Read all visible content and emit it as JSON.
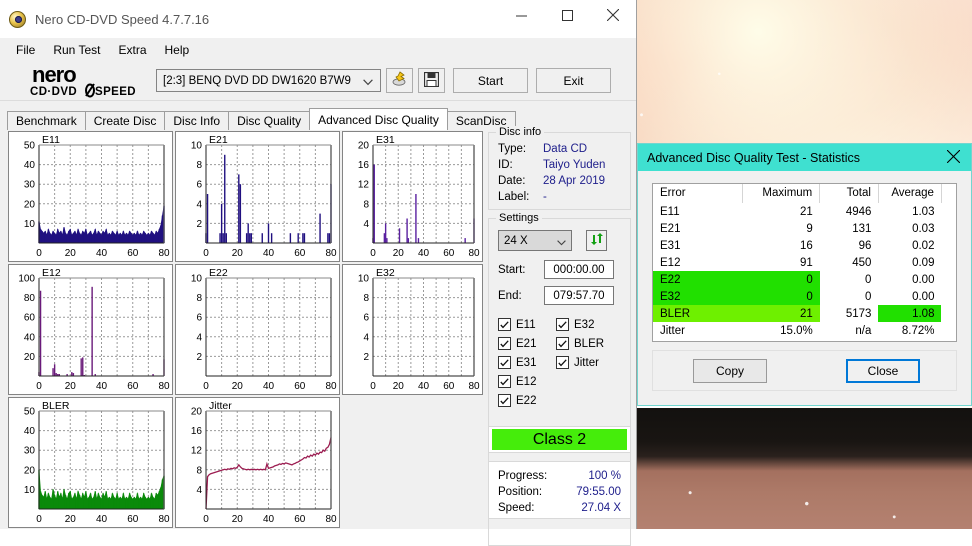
{
  "window": {
    "title": "Nero CD-DVD Speed 4.7.7.16",
    "icon": "nero-disc-icon",
    "minimize_label": "─",
    "maximize_label": "□",
    "close_label": "✕"
  },
  "menubar": {
    "items": [
      "File",
      "Run Test",
      "Extra",
      "Help"
    ]
  },
  "toolbar": {
    "logo_primary": "nero",
    "logo_secondary": "CD·DVD SPEED",
    "drive": "[2:3]   BENQ DVD DD DW1620 B7W9",
    "eject_icon": "eject-disc-icon",
    "save_icon": "floppy-save-icon",
    "start_label": "Start",
    "exit_label": "Exit"
  },
  "tabs": [
    {
      "label": "Benchmark",
      "active": false
    },
    {
      "label": "Create Disc",
      "active": false
    },
    {
      "label": "Disc Info",
      "active": false
    },
    {
      "label": "Disc Quality",
      "active": false
    },
    {
      "label": "Advanced Disc Quality",
      "active": true
    },
    {
      "label": "ScanDisc",
      "active": false
    }
  ],
  "disc_info": {
    "legend": "Disc info",
    "rows": [
      {
        "key": "Type:",
        "value": "Data CD"
      },
      {
        "key": "ID:",
        "value": "Taiyo Yuden"
      },
      {
        "key": "Date:",
        "value": "28 Apr 2019"
      },
      {
        "key": "Label:",
        "value": "-"
      }
    ]
  },
  "settings": {
    "legend": "Settings",
    "speed": "24 X",
    "refresh_icon": "refresh-icon",
    "start_label": "Start:",
    "start_value": "000:00.00",
    "end_label": "End:",
    "end_value": "079:57.70",
    "checkboxes_left": [
      {
        "label": "E11",
        "checked": true
      },
      {
        "label": "E21",
        "checked": true
      },
      {
        "label": "E31",
        "checked": true
      },
      {
        "label": "E12",
        "checked": true
      },
      {
        "label": "E22",
        "checked": true
      }
    ],
    "checkboxes_right": [
      {
        "label": "E32",
        "checked": true
      },
      {
        "label": "BLER",
        "checked": true
      },
      {
        "label": "Jitter",
        "checked": true
      }
    ]
  },
  "result": {
    "class_label": "Class 2",
    "class_color": "#45ed0b"
  },
  "progress": {
    "rows": [
      {
        "key": "Progress:",
        "value": "100 %"
      },
      {
        "key": "Position:",
        "value": "79:55.00"
      },
      {
        "key": "Speed:",
        "value": "27.04 X"
      }
    ]
  },
  "stats_dialog": {
    "title": "Advanced Disc Quality Test - Statistics",
    "close_icon": "close-icon",
    "columns": [
      "Error",
      "Maximum",
      "Total",
      "Average"
    ],
    "rows": [
      {
        "error": "E11",
        "maximum": "21",
        "total": "4946",
        "average": "1.03",
        "highlight": "none"
      },
      {
        "error": "E21",
        "maximum": "9",
        "total": "131",
        "average": "0.03",
        "highlight": "none"
      },
      {
        "error": "E31",
        "maximum": "16",
        "total": "96",
        "average": "0.02",
        "highlight": "none"
      },
      {
        "error": "E12",
        "maximum": "91",
        "total": "450",
        "average": "0.09",
        "highlight": "none"
      },
      {
        "error": "E22",
        "maximum": "0",
        "total": "0",
        "average": "0.00",
        "highlight": "left"
      },
      {
        "error": "E32",
        "maximum": "0",
        "total": "0",
        "average": "0.00",
        "highlight": "left"
      },
      {
        "error": "BLER",
        "maximum": "21",
        "total": "5173",
        "average": "1.08",
        "highlight": "bler"
      },
      {
        "error": "Jitter",
        "maximum": "15.0%",
        "total": "n/a",
        "average": "8.72%",
        "highlight": "none"
      }
    ],
    "copy_label": "Copy",
    "close_label": "Close"
  },
  "chart_data": [
    {
      "type": "area",
      "title": "E11",
      "xlabel": "",
      "ylabel": "",
      "color": "#201080",
      "xlim": [
        0,
        80
      ],
      "ylim": [
        0,
        50
      ],
      "xticks": [
        0,
        20,
        40,
        60,
        80
      ],
      "yticks": [
        10,
        20,
        30,
        40,
        50
      ],
      "grid": true,
      "values": [
        11,
        7,
        6,
        5,
        6,
        4,
        7,
        5,
        4,
        6,
        5,
        4,
        7,
        5,
        6,
        4,
        8,
        5,
        4,
        6,
        7,
        4,
        5,
        6,
        4,
        7,
        5,
        4,
        6,
        5,
        7,
        4,
        5,
        6,
        4,
        5,
        7,
        4,
        6,
        5,
        4,
        6,
        5,
        7,
        4,
        5,
        4,
        6,
        5,
        4,
        6,
        4,
        5,
        4,
        6,
        4,
        5,
        4,
        6,
        5,
        4,
        5,
        4,
        6,
        4,
        5,
        4,
        6,
        5,
        4,
        5,
        4,
        6,
        5,
        4,
        6,
        5,
        7,
        9,
        14,
        19
      ]
    },
    {
      "type": "bar",
      "title": "E21",
      "xlabel": "",
      "ylabel": "",
      "color": "#201080",
      "xlim": [
        0,
        80
      ],
      "ylim": [
        0,
        10
      ],
      "xticks": [
        0,
        20,
        40,
        60,
        80
      ],
      "yticks": [
        2,
        4,
        6,
        8,
        10
      ],
      "grid": true,
      "values": [
        1,
        5,
        0,
        0,
        0,
        0,
        0,
        0,
        0,
        1,
        4,
        1,
        9,
        1,
        0,
        0,
        0,
        0,
        0,
        0,
        0,
        7,
        6,
        0,
        0,
        0,
        1,
        2,
        1,
        1,
        0,
        0,
        0,
        0,
        0,
        0,
        1,
        0,
        0,
        0,
        2,
        0,
        1,
        0,
        0,
        0,
        0,
        0,
        0,
        0,
        0,
        0,
        0,
        0,
        1,
        0,
        0,
        0,
        0,
        1,
        0,
        0,
        1,
        1,
        0,
        0,
        0,
        0,
        0,
        0,
        0,
        0,
        0,
        3,
        0,
        0,
        0,
        0,
        1,
        1,
        6
      ]
    },
    {
      "type": "bar",
      "title": "E31",
      "xlabel": "",
      "ylabel": "",
      "color": "#5a20a0",
      "xlim": [
        0,
        80
      ],
      "ylim": [
        0,
        20
      ],
      "xticks": [
        0,
        20,
        40,
        60,
        80
      ],
      "yticks": [
        4,
        8,
        12,
        16,
        20
      ],
      "grid": true,
      "values": [
        1,
        16,
        0,
        0,
        0,
        0,
        0,
        0,
        0,
        2,
        4,
        1,
        0,
        0,
        0,
        0,
        0,
        0,
        0,
        0,
        0,
        3,
        0,
        0,
        0,
        0,
        0,
        5,
        1,
        0,
        0,
        0,
        0,
        0,
        10,
        0,
        1,
        0,
        0,
        0,
        0,
        0,
        0,
        0,
        0,
        0,
        0,
        0,
        0,
        0,
        0,
        0,
        0,
        0,
        0,
        0,
        0,
        0,
        0,
        0,
        0,
        0,
        0,
        0,
        0,
        0,
        0,
        0,
        0,
        0,
        0,
        0,
        0,
        1,
        0,
        0,
        0,
        0,
        0,
        0,
        5
      ]
    },
    {
      "type": "bar",
      "title": "E12",
      "xlabel": "",
      "ylabel": "",
      "color": "#6a1a7a",
      "xlim": [
        0,
        80
      ],
      "ylim": [
        0,
        100
      ],
      "xticks": [
        0,
        20,
        40,
        60,
        80
      ],
      "yticks": [
        20,
        40,
        60,
        80,
        100
      ],
      "grid": true,
      "values": [
        4,
        87,
        0,
        0,
        0,
        0,
        0,
        0,
        0,
        8,
        12,
        3,
        2,
        2,
        0,
        0,
        0,
        0,
        2,
        0,
        0,
        4,
        3,
        0,
        0,
        0,
        0,
        18,
        19,
        1,
        0,
        0,
        0,
        0,
        91,
        0,
        2,
        0,
        0,
        0,
        0,
        0,
        0,
        0,
        0,
        0,
        0,
        0,
        0,
        0,
        0,
        0,
        0,
        0,
        0,
        0,
        0,
        0,
        0,
        0,
        0,
        0,
        0,
        0,
        0,
        0,
        0,
        0,
        0,
        0,
        0,
        0,
        0,
        2,
        0,
        0,
        0,
        0,
        0,
        0,
        17
      ]
    },
    {
      "type": "bar",
      "title": "E22",
      "xlabel": "",
      "ylabel": "",
      "color": "#201080",
      "xlim": [
        0,
        80
      ],
      "ylim": [
        0,
        10
      ],
      "xticks": [
        0,
        20,
        40,
        60,
        80
      ],
      "yticks": [
        2,
        4,
        6,
        8,
        10
      ],
      "grid": true,
      "values": []
    },
    {
      "type": "bar",
      "title": "E32",
      "xlabel": "",
      "ylabel": "",
      "color": "#201080",
      "xlim": [
        0,
        80
      ],
      "ylim": [
        0,
        10
      ],
      "xticks": [
        0,
        20,
        40,
        60,
        80
      ],
      "yticks": [
        2,
        4,
        6,
        8,
        10
      ],
      "grid": true,
      "values": []
    },
    {
      "type": "area",
      "title": "BLER",
      "xlabel": "",
      "ylabel": "",
      "color": "#0a8a0a",
      "xlim": [
        0,
        80
      ],
      "ylim": [
        0,
        50
      ],
      "xticks": [
        0,
        20,
        40,
        60,
        80
      ],
      "yticks": [
        10,
        20,
        30,
        40,
        50
      ],
      "grid": true,
      "values": [
        20,
        9,
        7,
        6,
        9,
        5,
        8,
        6,
        5,
        10,
        7,
        5,
        9,
        6,
        8,
        5,
        10,
        7,
        5,
        8,
        9,
        5,
        6,
        8,
        5,
        9,
        7,
        5,
        8,
        6,
        9,
        5,
        6,
        8,
        5,
        6,
        9,
        5,
        8,
        6,
        5,
        8,
        6,
        9,
        5,
        6,
        5,
        8,
        6,
        5,
        8,
        5,
        6,
        5,
        8,
        5,
        6,
        5,
        8,
        6,
        5,
        6,
        5,
        8,
        5,
        6,
        5,
        8,
        6,
        5,
        6,
        5,
        8,
        6,
        5,
        8,
        7,
        9,
        11,
        15,
        17
      ]
    },
    {
      "type": "line",
      "title": "Jitter",
      "xlabel": "",
      "ylabel": "",
      "color": "#9c1d51",
      "xlim": [
        0,
        80
      ],
      "ylim": [
        0,
        20
      ],
      "xticks": [
        0,
        20,
        40,
        60,
        80
      ],
      "yticks": [
        4,
        8,
        12,
        16,
        20
      ],
      "grid": true,
      "values": [
        0,
        6.6,
        7.0,
        7.2,
        7.3,
        7.4,
        7.5,
        7.6,
        7.7,
        7.8,
        7.9,
        8.0,
        8.1,
        8.0,
        8.2,
        8.1,
        8.3,
        8.2,
        8.4,
        8.3,
        8.5,
        9.0,
        8.6,
        8.3,
        8.2,
        8.1,
        8.0,
        8.1,
        8.0,
        8.1,
        8.0,
        8.1,
        8.0,
        8.1,
        8.0,
        8.1,
        8.0,
        8.1,
        8.0,
        9.2,
        8.3,
        8.4,
        8.5,
        8.6,
        8.8,
        8.9,
        9.0,
        9.2,
        9.1,
        9.3,
        9.2,
        9.4,
        9.3,
        9.2,
        9.1,
        9.0,
        9.2,
        9.3,
        9.5,
        9.6,
        9.8,
        10.0,
        10.2,
        10.5,
        10.4,
        10.8,
        10.6,
        11.0,
        10.8,
        11.2,
        11.0,
        11.4,
        11.2,
        11.6,
        11.5,
        12.0,
        11.8,
        12.4,
        12.6,
        13.2,
        14.6
      ]
    }
  ]
}
